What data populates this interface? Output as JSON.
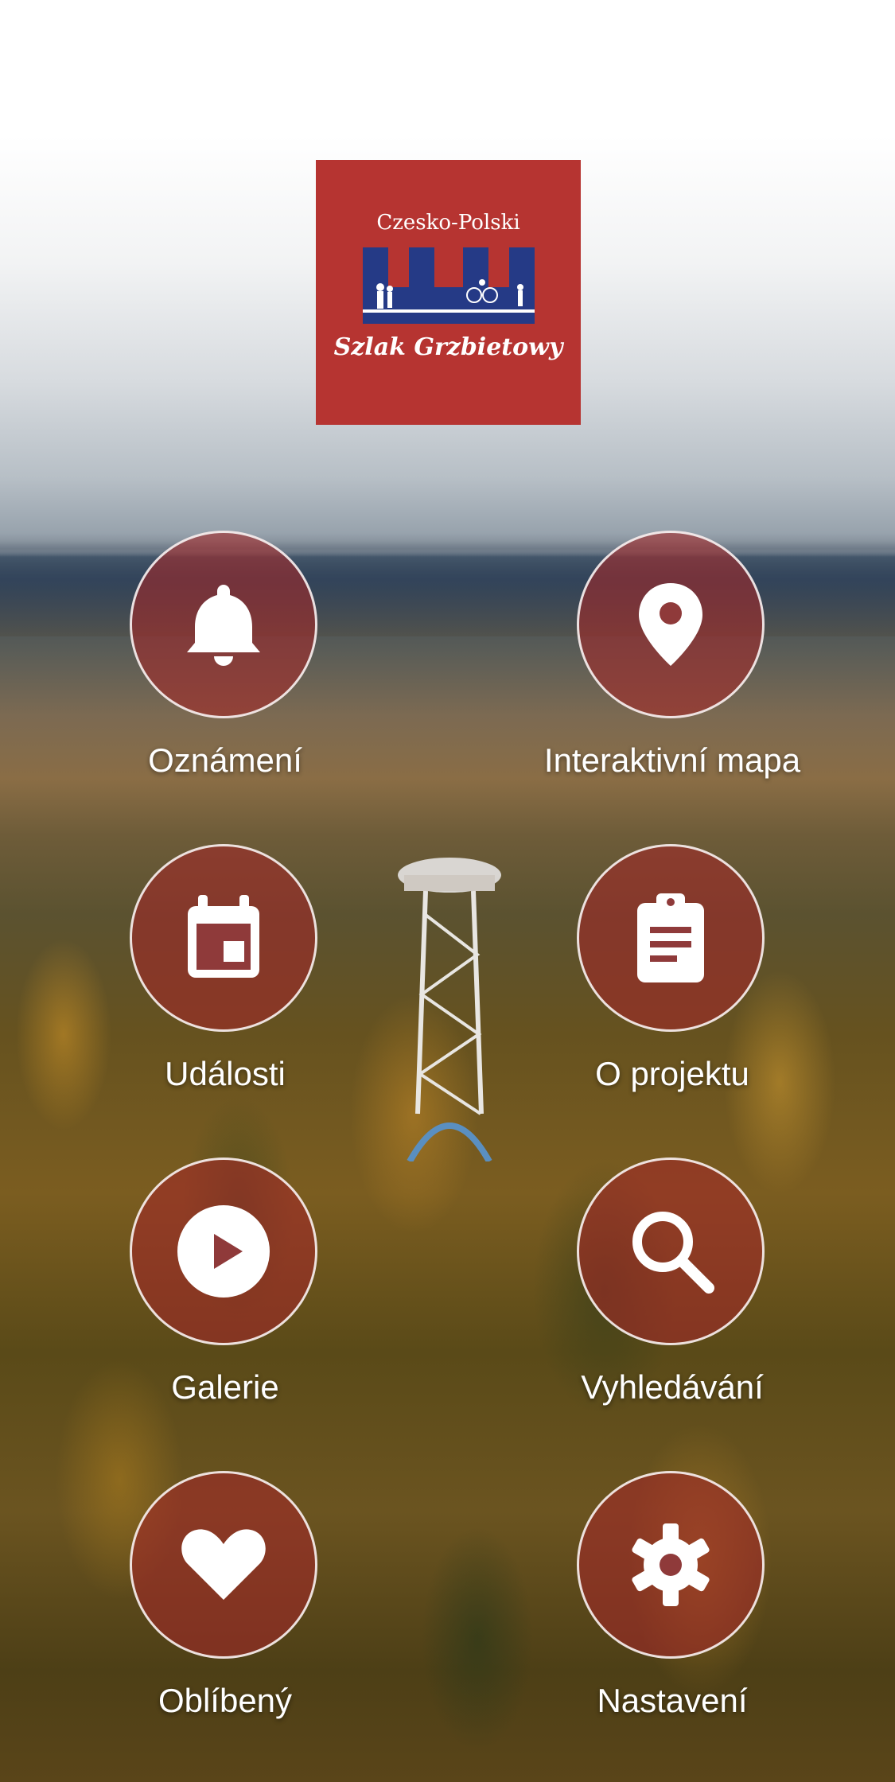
{
  "logo": {
    "top_text": "Czesko-Polski",
    "bottom_text": "Szlak Grzbietowy",
    "color": "#b63431"
  },
  "menu": {
    "items": [
      {
        "label": "Oznámení",
        "icon": "bell-icon"
      },
      {
        "label": "Interaktivní mapa",
        "icon": "map-pin-icon"
      },
      {
        "label": "Události",
        "icon": "calendar-icon"
      },
      {
        "label": "O projektu",
        "icon": "clipboard-icon"
      },
      {
        "label": "Galerie",
        "icon": "play-icon"
      },
      {
        "label": "Vyhledávání",
        "icon": "search-icon"
      },
      {
        "label": "Oblíbený",
        "icon": "heart-icon"
      },
      {
        "label": "Nastavení",
        "icon": "gear-icon"
      }
    ],
    "circle_color": "#a02828"
  }
}
